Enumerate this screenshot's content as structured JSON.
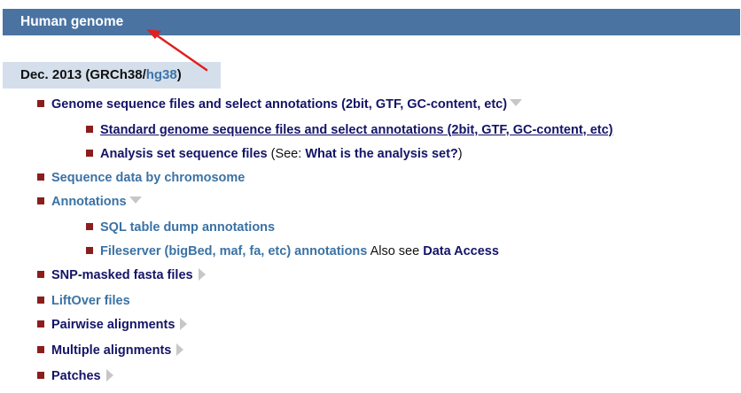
{
  "header": {
    "title": "Human genome"
  },
  "version": {
    "label_prefix": "Dec. 2013 (GRCh38/",
    "assembly_link": "hg38",
    "label_suffix": ")"
  },
  "items": {
    "genome_sequence": "Genome sequence files and select annotations (2bit, GTF, GC-content, etc)",
    "standard_genome": "Standard genome sequence files and select annotations (2bit, GTF, GC-content, etc)",
    "analysis_set": "Analysis set sequence files",
    "analysis_see_prefix": " (See: ",
    "analysis_what_is": "What is the analysis set?",
    "analysis_see_suffix": ")",
    "sequence_by_chromosome": "Sequence data by chromosome",
    "annotations": "Annotations",
    "sql_dump": "SQL table dump annotations",
    "fileserver": "Fileserver (bigBed, maf, fa, etc) annotations",
    "also_see": " Also see ",
    "data_access": "Data Access",
    "snp_masked": "SNP-masked fasta files",
    "liftover": "LiftOver files",
    "pairwise": "Pairwise alignments",
    "multiple": "Multiple alignments",
    "patches": "Patches"
  },
  "colors": {
    "header_bg": "#4a73a2",
    "version_bg": "#d4dfeb",
    "bullet": "#8b1d1d",
    "dark_link": "#141468",
    "blue_link": "#3b72a4",
    "annotation_arrow": "#e02020"
  },
  "icons": {
    "expanded": "triangle-down-icon",
    "collapsed": "triangle-right-icon"
  }
}
